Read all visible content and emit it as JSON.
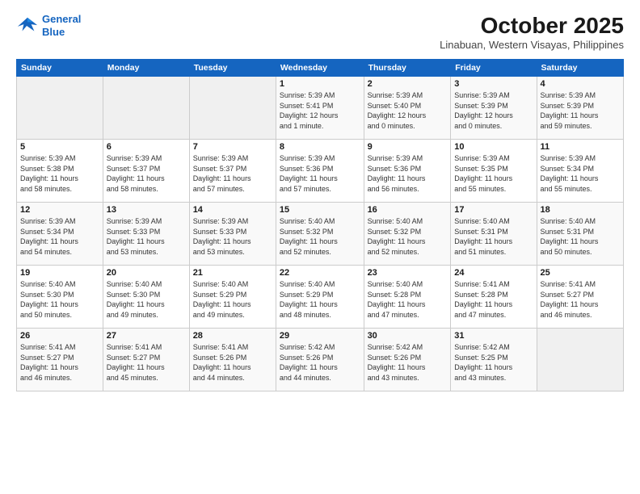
{
  "header": {
    "logo_line1": "General",
    "logo_line2": "Blue",
    "month_title": "October 2025",
    "subtitle": "Linabuan, Western Visayas, Philippines"
  },
  "days_of_week": [
    "Sunday",
    "Monday",
    "Tuesday",
    "Wednesday",
    "Thursday",
    "Friday",
    "Saturday"
  ],
  "weeks": [
    [
      {
        "num": "",
        "info": ""
      },
      {
        "num": "",
        "info": ""
      },
      {
        "num": "",
        "info": ""
      },
      {
        "num": "1",
        "info": "Sunrise: 5:39 AM\nSunset: 5:41 PM\nDaylight: 12 hours\nand 1 minute."
      },
      {
        "num": "2",
        "info": "Sunrise: 5:39 AM\nSunset: 5:40 PM\nDaylight: 12 hours\nand 0 minutes."
      },
      {
        "num": "3",
        "info": "Sunrise: 5:39 AM\nSunset: 5:39 PM\nDaylight: 12 hours\nand 0 minutes."
      },
      {
        "num": "4",
        "info": "Sunrise: 5:39 AM\nSunset: 5:39 PM\nDaylight: 11 hours\nand 59 minutes."
      }
    ],
    [
      {
        "num": "5",
        "info": "Sunrise: 5:39 AM\nSunset: 5:38 PM\nDaylight: 11 hours\nand 58 minutes."
      },
      {
        "num": "6",
        "info": "Sunrise: 5:39 AM\nSunset: 5:37 PM\nDaylight: 11 hours\nand 58 minutes."
      },
      {
        "num": "7",
        "info": "Sunrise: 5:39 AM\nSunset: 5:37 PM\nDaylight: 11 hours\nand 57 minutes."
      },
      {
        "num": "8",
        "info": "Sunrise: 5:39 AM\nSunset: 5:36 PM\nDaylight: 11 hours\nand 57 minutes."
      },
      {
        "num": "9",
        "info": "Sunrise: 5:39 AM\nSunset: 5:36 PM\nDaylight: 11 hours\nand 56 minutes."
      },
      {
        "num": "10",
        "info": "Sunrise: 5:39 AM\nSunset: 5:35 PM\nDaylight: 11 hours\nand 55 minutes."
      },
      {
        "num": "11",
        "info": "Sunrise: 5:39 AM\nSunset: 5:34 PM\nDaylight: 11 hours\nand 55 minutes."
      }
    ],
    [
      {
        "num": "12",
        "info": "Sunrise: 5:39 AM\nSunset: 5:34 PM\nDaylight: 11 hours\nand 54 minutes."
      },
      {
        "num": "13",
        "info": "Sunrise: 5:39 AM\nSunset: 5:33 PM\nDaylight: 11 hours\nand 53 minutes."
      },
      {
        "num": "14",
        "info": "Sunrise: 5:39 AM\nSunset: 5:33 PM\nDaylight: 11 hours\nand 53 minutes."
      },
      {
        "num": "15",
        "info": "Sunrise: 5:40 AM\nSunset: 5:32 PM\nDaylight: 11 hours\nand 52 minutes."
      },
      {
        "num": "16",
        "info": "Sunrise: 5:40 AM\nSunset: 5:32 PM\nDaylight: 11 hours\nand 52 minutes."
      },
      {
        "num": "17",
        "info": "Sunrise: 5:40 AM\nSunset: 5:31 PM\nDaylight: 11 hours\nand 51 minutes."
      },
      {
        "num": "18",
        "info": "Sunrise: 5:40 AM\nSunset: 5:31 PM\nDaylight: 11 hours\nand 50 minutes."
      }
    ],
    [
      {
        "num": "19",
        "info": "Sunrise: 5:40 AM\nSunset: 5:30 PM\nDaylight: 11 hours\nand 50 minutes."
      },
      {
        "num": "20",
        "info": "Sunrise: 5:40 AM\nSunset: 5:30 PM\nDaylight: 11 hours\nand 49 minutes."
      },
      {
        "num": "21",
        "info": "Sunrise: 5:40 AM\nSunset: 5:29 PM\nDaylight: 11 hours\nand 49 minutes."
      },
      {
        "num": "22",
        "info": "Sunrise: 5:40 AM\nSunset: 5:29 PM\nDaylight: 11 hours\nand 48 minutes."
      },
      {
        "num": "23",
        "info": "Sunrise: 5:40 AM\nSunset: 5:28 PM\nDaylight: 11 hours\nand 47 minutes."
      },
      {
        "num": "24",
        "info": "Sunrise: 5:41 AM\nSunset: 5:28 PM\nDaylight: 11 hours\nand 47 minutes."
      },
      {
        "num": "25",
        "info": "Sunrise: 5:41 AM\nSunset: 5:27 PM\nDaylight: 11 hours\nand 46 minutes."
      }
    ],
    [
      {
        "num": "26",
        "info": "Sunrise: 5:41 AM\nSunset: 5:27 PM\nDaylight: 11 hours\nand 46 minutes."
      },
      {
        "num": "27",
        "info": "Sunrise: 5:41 AM\nSunset: 5:27 PM\nDaylight: 11 hours\nand 45 minutes."
      },
      {
        "num": "28",
        "info": "Sunrise: 5:41 AM\nSunset: 5:26 PM\nDaylight: 11 hours\nand 44 minutes."
      },
      {
        "num": "29",
        "info": "Sunrise: 5:42 AM\nSunset: 5:26 PM\nDaylight: 11 hours\nand 44 minutes."
      },
      {
        "num": "30",
        "info": "Sunrise: 5:42 AM\nSunset: 5:26 PM\nDaylight: 11 hours\nand 43 minutes."
      },
      {
        "num": "31",
        "info": "Sunrise: 5:42 AM\nSunset: 5:25 PM\nDaylight: 11 hours\nand 43 minutes."
      },
      {
        "num": "",
        "info": ""
      }
    ]
  ]
}
